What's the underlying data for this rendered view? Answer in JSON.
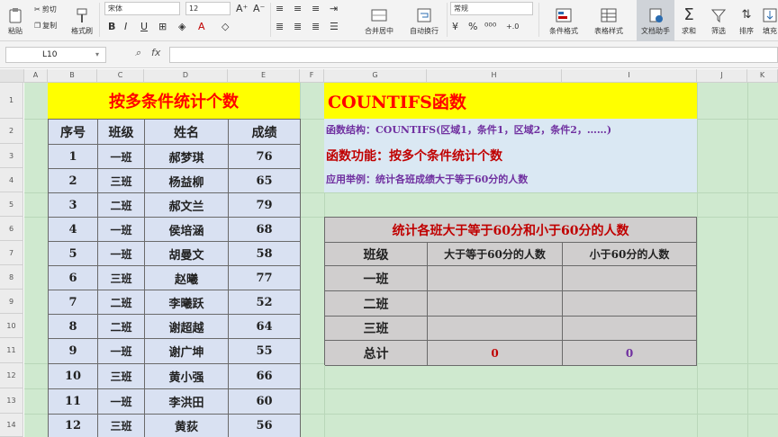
{
  "ribbon": {
    "paste": "粘贴",
    "cut": "剪切",
    "copy": "复制",
    "format_painter": "格式刷",
    "font_name": "宋体",
    "font_size": "12",
    "merge_center": "合并居中",
    "wrap_text": "自动换行",
    "number_format": "常规",
    "conditional_format": "条件格式",
    "table_style": "表格样式",
    "doc_assistant": "文档助手",
    "sum": "求和",
    "filter": "筛选",
    "sort": "排序",
    "fill": "填充"
  },
  "formula_bar": {
    "name_box": "L10",
    "fx": "fx"
  },
  "columns": [
    "A",
    "B",
    "C",
    "D",
    "E",
    "F",
    "G",
    "H",
    "I",
    "J",
    "K"
  ],
  "rows": [
    "1",
    "2",
    "3",
    "4",
    "5",
    "6",
    "7",
    "8",
    "9",
    "10",
    "11",
    "12",
    "13",
    "14"
  ],
  "left_table": {
    "title": "按多条件统计个数",
    "headers": [
      "序号",
      "班级",
      "姓名",
      "成绩"
    ],
    "rows": [
      [
        "1",
        "一班",
        "郝梦琪",
        "76"
      ],
      [
        "2",
        "三班",
        "杨益柳",
        "65"
      ],
      [
        "3",
        "二班",
        "郝文兰",
        "79"
      ],
      [
        "4",
        "一班",
        "侯培涵",
        "68"
      ],
      [
        "5",
        "一班",
        "胡曼文",
        "58"
      ],
      [
        "6",
        "三班",
        "赵曦",
        "77"
      ],
      [
        "7",
        "二班",
        "李曦跃",
        "52"
      ],
      [
        "8",
        "二班",
        "谢超越",
        "64"
      ],
      [
        "9",
        "一班",
        "谢广坤",
        "55"
      ],
      [
        "10",
        "三班",
        "黄小强",
        "66"
      ],
      [
        "11",
        "一班",
        "李洪田",
        "60"
      ],
      [
        "12",
        "三班",
        "黄荻",
        "56"
      ]
    ]
  },
  "info": {
    "title": "COUNTIFS函数",
    "structure": "函数结构：COUNTIFS(区域1，条件1，区域2，条件2，……)",
    "function": "函数功能：按多个条件统计个数",
    "example": "应用举例：统计各班成绩大于等于60分的人数"
  },
  "summary": {
    "title": "统计各班大于等于60分和小于60分的人数",
    "headers": [
      "班级",
      "大于等于60分的人数",
      "小于60分的人数"
    ],
    "classes": [
      "一班",
      "二班",
      "三班"
    ],
    "total_label": "总计",
    "total_ge60": "0",
    "total_lt60": "0"
  },
  "colors": {
    "title_red": "#ff0000",
    "purple_text": "#7030a0",
    "dark_red": "#c00000",
    "yellow": "#ffff00",
    "sheet_bg": "#cfe9cf"
  }
}
